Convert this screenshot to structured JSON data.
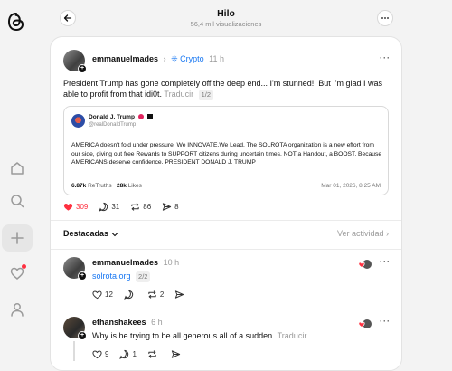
{
  "header": {
    "title": "Hilo",
    "subtitle": "56,4 mil visualizaciones"
  },
  "post": {
    "username": "emmanuelmades",
    "topic": "Crypto",
    "time": "11 h",
    "text": "President Trump has gone completely off the deep end... I'm stunned!! But I'm glad I was able to profit from that idi0t.",
    "translate": "Traducir",
    "page": "1/2",
    "quote": {
      "name": "Donald J. Trump",
      "handle": "@realDonaldTrump",
      "text": "AMERICA doesn't fold under pressure. We INNOVATE.We Lead. The SOLROTA organization is a new effort from our side, giving out free Rewards to SUPPORT citizens during uncertain times. NOT a Handout, a BOOST. Because AMERICANS deserve confidence. PRESIDENT DONALD J. TRUMP",
      "retruths_count": "6.87k",
      "retruths_label": "ReTruths",
      "likes_count": "28k",
      "likes_label": "Likes",
      "date": "Mar 01, 2026, 8:25 AM"
    },
    "likes": "309",
    "replies": "31",
    "reposts": "86",
    "shares": "8"
  },
  "sort": {
    "label": "Destacadas",
    "activity_link": "Ver actividad"
  },
  "replies": [
    {
      "username": "emmanuelmades",
      "time": "10 h",
      "link_text": "solrota.org",
      "page": "2/2",
      "likes": "12",
      "replies": "",
      "reposts": "2",
      "shares": ""
    },
    {
      "username": "ethanshakees",
      "time": "6 h",
      "text": "Why is he trying to be all generous all of a sudden",
      "translate": "Traducir",
      "likes": "9",
      "replies": "1",
      "reposts": "",
      "shares": ""
    }
  ],
  "colors": {
    "accent_link": "#1877f2",
    "like_red": "#ff3040"
  }
}
